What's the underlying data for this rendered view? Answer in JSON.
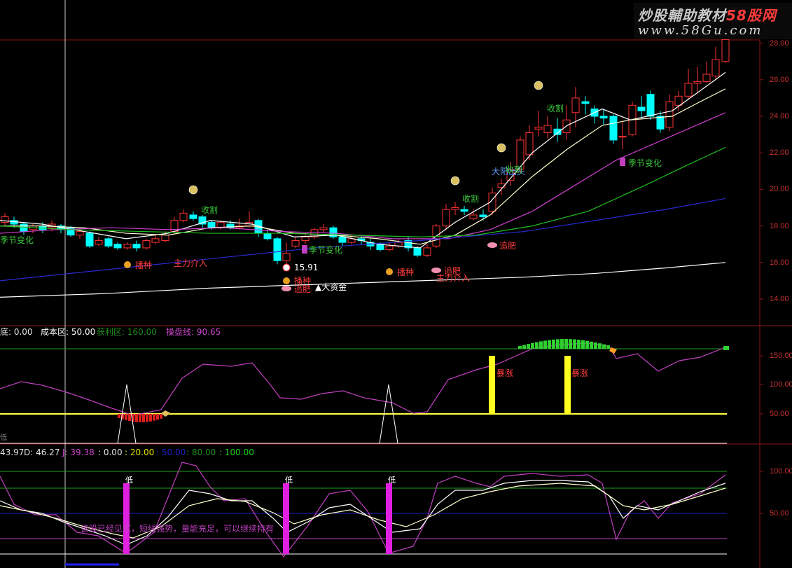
{
  "watermark": {
    "title_a": "炒股輔助教材",
    "title_b": "58股网",
    "url": "www.58Gu.com"
  },
  "price_axis": [
    "28.00",
    "26.00",
    "24.00",
    "22.00",
    "20.00",
    "18.00",
    "16.00",
    "14.00"
  ],
  "ind1_axis": [
    "150.00",
    "100.00",
    "50.00"
  ],
  "ind2_axis": [
    "100.00",
    "50.00"
  ],
  "ind1_header": [
    {
      "text": "底: 0.00",
      "color": "#e0e0e0"
    },
    {
      "text": "成本区: 50.00",
      "color": "#ffffff"
    },
    {
      "text": "获利区: 160.00",
      "color": "#1e8c1e"
    },
    {
      "text": "操盘线: 90.65",
      "color": "#cc44cc"
    }
  ],
  "ind2_header": [
    {
      "text": "43.97",
      "color": "#e0e0e0"
    },
    {
      "text": "D: 46.27",
      "color": "#e0e0e0"
    },
    {
      "text": "J: 39.38",
      "color": "#cc44cc"
    },
    {
      "text": ": 0.00",
      "color": "#e0e0e0"
    },
    {
      "text": ": 20.00",
      "color": "#e0e000"
    },
    {
      "text": ": 50.00",
      "color": "#2020c0"
    },
    {
      "text": ": 80.00",
      "color": "#1e8c1e"
    },
    {
      "text": ": 100.00",
      "color": "#1ed01e"
    }
  ],
  "price_labels": [
    {
      "text": "季节变化",
      "color": "#3cc83c"
    },
    {
      "text": "播种",
      "color": "#ff3c3c"
    },
    {
      "text": "主力介入",
      "color": "#ff3c3c"
    },
    {
      "text": "收割",
      "color": "#3cc83c"
    },
    {
      "text": "季节变化",
      "color": "#3cc83c"
    },
    {
      "text": "15.91",
      "color": "#ffffff"
    },
    {
      "text": "播种",
      "color": "#ff3c3c"
    },
    {
      "text": "追肥",
      "color": "#ff3c3c"
    },
    {
      "text": "▲大资金",
      "color": "#ffffff"
    },
    {
      "text": "播种",
      "color": "#ff3c3c"
    },
    {
      "text": "追肥",
      "color": "#ff3c3c"
    },
    {
      "text": "主力介入",
      "color": "#ff3c3c"
    },
    {
      "text": "收割",
      "color": "#3cc83c"
    },
    {
      "text": "追肥",
      "color": "#ff3c3c"
    },
    {
      "text": "大阳出头",
      "color": "#60a0ff"
    },
    {
      "text": "收割",
      "color": "#3cc83c"
    },
    {
      "text": "收割",
      "color": "#3cc83c"
    },
    {
      "text": "季节变化",
      "color": "#3cc83c"
    }
  ],
  "ind1_labels": [
    {
      "text": "暴涨",
      "color": "#ff3c3c"
    },
    {
      "text": "暴涨",
      "color": "#ff3c3c"
    }
  ],
  "ind2_labels": [
    {
      "text": "低",
      "color": "#ffffff"
    },
    {
      "text": "低",
      "color": "#ffffff"
    },
    {
      "text": "低",
      "color": "#ffffff"
    }
  ],
  "ind2_note": "该股已经见底，短线强势，量能充足，可以继续持有",
  "corner_label": "低",
  "colors": {
    "up": "#ff3232",
    "down": "#00ffff",
    "grid": "#8c1414",
    "ma5": "#ffffff",
    "ma10": "#ffffcc",
    "ma20": "#d040d0",
    "ma60": "#20c020",
    "ma120": "#ffffff",
    "ma250": "#2a2ad0",
    "cyan": "#00ffff"
  }
}
